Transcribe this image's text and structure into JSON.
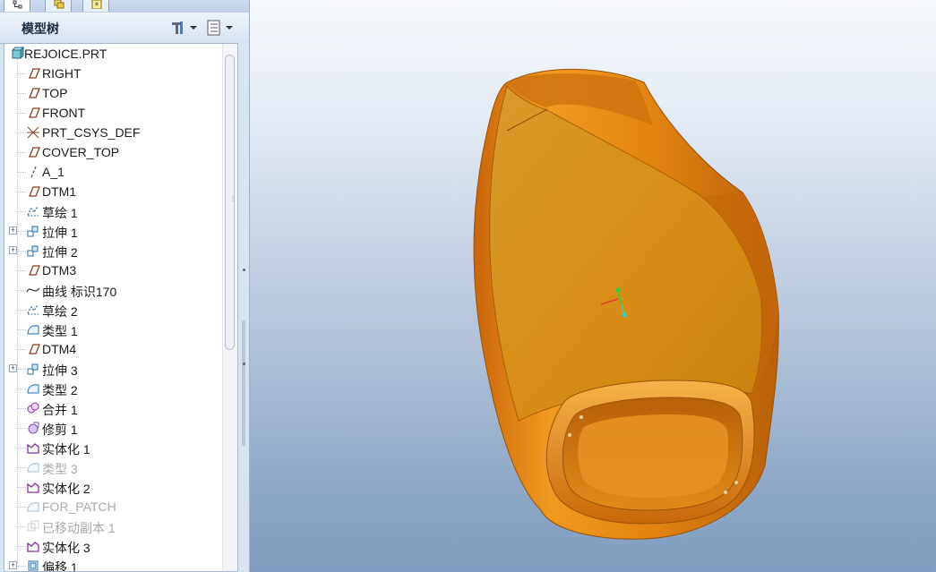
{
  "panel": {
    "title": "模型树",
    "top_tabs": [
      "model-tree-tab",
      "layer-tab",
      "favorites-tab"
    ]
  },
  "tree": {
    "root": {
      "label": "REJOICE.PRT",
      "icon": "part-icon"
    },
    "items": [
      {
        "label": "RIGHT",
        "icon": "datum-plane-icon",
        "expandable": false,
        "disabled": false
      },
      {
        "label": "TOP",
        "icon": "datum-plane-icon",
        "expandable": false,
        "disabled": false
      },
      {
        "label": "FRONT",
        "icon": "datum-plane-icon",
        "expandable": false,
        "disabled": false
      },
      {
        "label": "PRT_CSYS_DEF",
        "icon": "coordinate-system-icon",
        "expandable": false,
        "disabled": false
      },
      {
        "label": "COVER_TOP",
        "icon": "datum-plane-icon",
        "expandable": false,
        "disabled": false
      },
      {
        "label": "A_1",
        "icon": "datum-axis-icon",
        "expandable": false,
        "disabled": false
      },
      {
        "label": "DTM1",
        "icon": "datum-plane-icon",
        "expandable": false,
        "disabled": false
      },
      {
        "label": "草绘 1",
        "icon": "sketch-icon",
        "expandable": false,
        "disabled": false
      },
      {
        "label": "拉伸 1",
        "icon": "extrude-icon",
        "expandable": true,
        "disabled": false
      },
      {
        "label": "拉伸 2",
        "icon": "extrude-icon",
        "expandable": true,
        "disabled": false
      },
      {
        "label": "DTM3",
        "icon": "datum-plane-icon",
        "expandable": false,
        "disabled": false
      },
      {
        "label": "曲线 标识170",
        "icon": "curve-icon",
        "expandable": false,
        "disabled": false
      },
      {
        "label": "草绘 2",
        "icon": "sketch-icon",
        "expandable": false,
        "disabled": false
      },
      {
        "label": "类型 1",
        "icon": "surface-icon",
        "expandable": false,
        "disabled": false
      },
      {
        "label": "DTM4",
        "icon": "datum-plane-icon",
        "expandable": false,
        "disabled": false
      },
      {
        "label": "拉伸 3",
        "icon": "extrude-icon",
        "expandable": true,
        "disabled": false
      },
      {
        "label": "类型 2",
        "icon": "surface-icon",
        "expandable": false,
        "disabled": false
      },
      {
        "label": "合并 1",
        "icon": "merge-icon",
        "expandable": false,
        "disabled": false
      },
      {
        "label": "修剪 1",
        "icon": "trim-icon",
        "expandable": false,
        "disabled": false
      },
      {
        "label": "实体化 1",
        "icon": "solidify-icon",
        "expandable": false,
        "disabled": false
      },
      {
        "label": "类型 3",
        "icon": "surface-icon",
        "expandable": false,
        "disabled": true
      },
      {
        "label": "实体化 2",
        "icon": "solidify-icon",
        "expandable": false,
        "disabled": false
      },
      {
        "label": "FOR_PATCH",
        "icon": "surface-icon",
        "expandable": false,
        "disabled": true
      },
      {
        "label": "已移动副本 1",
        "icon": "moved-copy-icon",
        "expandable": false,
        "disabled": true
      },
      {
        "label": "实体化 3",
        "icon": "solidify-icon",
        "expandable": false,
        "disabled": false
      },
      {
        "label": "偏移 1",
        "icon": "offset-icon",
        "expandable": true,
        "disabled": false
      }
    ]
  },
  "colors": {
    "model_body": "#e58a12",
    "model_top_face": "#d89118",
    "model_dark": "#b3600a",
    "disabled_text": "#a9a9a9"
  }
}
